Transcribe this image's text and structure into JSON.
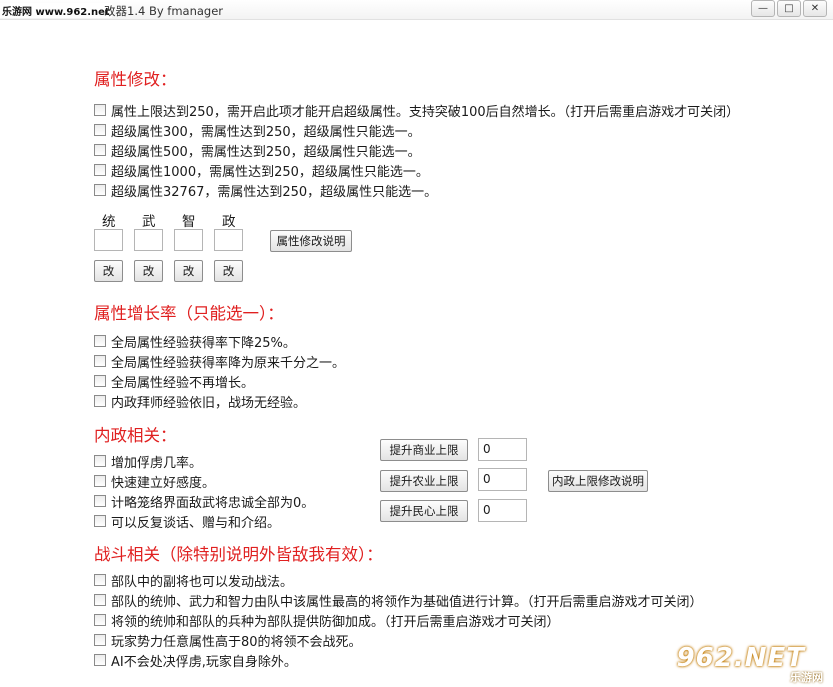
{
  "window": {
    "badge": "乐游网 www.962.net",
    "title": "改器1.4 By fmanager"
  },
  "sections": {
    "attr_modify": "属性修改：",
    "growth_rate": "属性增长率（只能选一）：",
    "domestic": "内政相关：",
    "battle": "战斗相关（除特别说明外皆敌我有效）："
  },
  "attr_options": [
    "属性上限达到250，需开启此项才能开启超级属性。支持突破100后自然增长。（打开后需重启游戏才可关闭）",
    "超级属性300，需属性达到250，超级属性只能选一。",
    "超级属性500，需属性达到250，超级属性只能选一。",
    "超级属性1000，需属性达到250，超级属性只能选一。",
    "超级属性32767，需属性达到250，超级属性只能选一。"
  ],
  "stats": {
    "labels": [
      "统",
      "武",
      "智",
      "政"
    ],
    "modify_label": "改",
    "help_button": "属性修改说明"
  },
  "growth_options": [
    "全局属性经验获得率下降25%。",
    "全局属性经验获得率降为原来千分之一。",
    "全局属性经验不再增长。",
    "内政拜师经验依旧，战场无经验。"
  ],
  "domestic_options": [
    "增加俘虏几率。",
    "快速建立好感度。",
    "计略笼络界面敌武将忠诚全部为0。",
    "可以反复谈话、赠与和介绍。"
  ],
  "domestic_controls": {
    "commerce_button": "提升商业上限",
    "commerce_value": "0",
    "agriculture_button": "提升农业上限",
    "agriculture_value": "0",
    "morale_button": "提升民心上限",
    "morale_value": "0",
    "help_button": "内政上限修改说明"
  },
  "battle_options": [
    "部队中的副将也可以发动战法。",
    "部队的统帅、武力和智力由队中该属性最高的将领作为基础值进行计算。（打开后需重启游戏才可关闭）",
    "将领的统帅和部队的兵种为部队提供防御加成。（打开后需重启游戏才可关闭）",
    "玩家势力任意属性高于80的将领不会战死。",
    "AI不会处决俘虏,玩家自身除外。"
  ],
  "watermark": {
    "logo": "962.NET",
    "sub": "乐游网"
  }
}
